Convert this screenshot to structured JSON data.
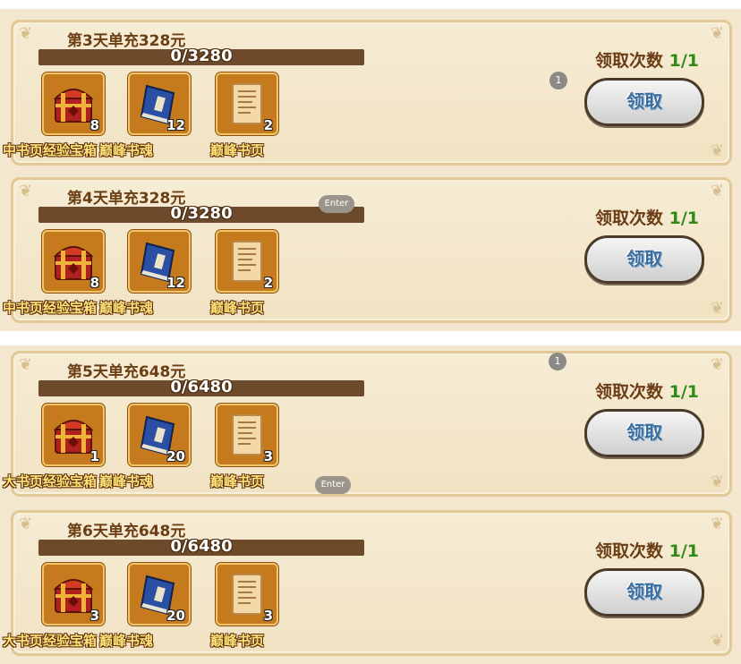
{
  "claim_label": "领取次数",
  "button_label": "领取",
  "panels": [
    {
      "title": "第3天单充328元",
      "progress_text": "0/3280",
      "progress": 0,
      "count": "1/1",
      "rewards": [
        {
          "name": "中书页经验宝箱",
          "qty": "8"
        },
        {
          "name": "巅峰书魂",
          "qty": "12"
        },
        {
          "name": "巅峰书页",
          "qty": "2"
        }
      ]
    },
    {
      "title": "第4天单充328元",
      "progress_text": "0/3280",
      "progress": 0,
      "count": "1/1",
      "rewards": [
        {
          "name": "中书页经验宝箱",
          "qty": "8"
        },
        {
          "name": "巅峰书魂",
          "qty": "12"
        },
        {
          "name": "巅峰书页",
          "qty": "2"
        }
      ]
    },
    {
      "title": "第5天单充648元",
      "progress_text": "0/6480",
      "progress": 0,
      "count": "1/1",
      "rewards": [
        {
          "name": "大书页经验宝箱",
          "qty": "1"
        },
        {
          "name": "巅峰书魂",
          "qty": "20"
        },
        {
          "name": "巅峰书页",
          "qty": "3"
        }
      ]
    },
    {
      "title": "第6天单充648元",
      "progress_text": "0/6480",
      "progress": 0,
      "count": "1/1",
      "rewards": [
        {
          "name": "大书页经验宝箱",
          "qty": "3"
        },
        {
          "name": "巅峰书魂",
          "qty": "20"
        },
        {
          "name": "巅峰书页",
          "qty": "3"
        }
      ]
    }
  ],
  "overlays": {
    "badge_label": "1",
    "enter_label": "Enter"
  }
}
